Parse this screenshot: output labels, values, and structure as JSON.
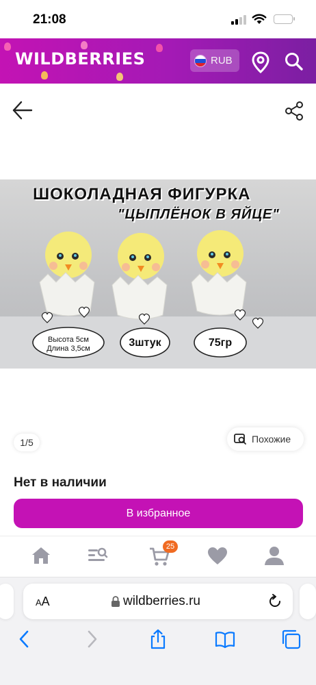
{
  "status_bar": {
    "time": "21:08"
  },
  "header": {
    "logo": "WILDBERRIES",
    "currency": "RUB"
  },
  "product": {
    "image": {
      "title": "ШОКОЛАДНАЯ ФИГУРКА",
      "subtitle": "\"ЦЫПЛЁНОК В ЯЙЦЕ\"",
      "label_height": "Высота 5см",
      "label_length": "Длина 3,5см",
      "label_count": "3штук",
      "label_weight": "75гр"
    },
    "page_counter": "1/5",
    "similar_label": "Похожие",
    "stock_status": "Нет в наличии",
    "favorite_button": "В избранное"
  },
  "tabbar": {
    "cart_badge": "25"
  },
  "browser": {
    "aa_label_small": "A",
    "aa_label_big": "A",
    "url": "wildberries.ru"
  },
  "colors": {
    "brand": "#c412b5",
    "badge": "#f06b22",
    "ios_blue": "#0a7aff"
  },
  "icons": [
    "signal-icon",
    "wifi-icon",
    "battery-icon",
    "location-icon",
    "search-icon",
    "back-arrow-icon",
    "share-icon",
    "similar-icon",
    "home-icon",
    "catalog-icon",
    "cart-icon",
    "heart-icon",
    "profile-icon",
    "lock-icon",
    "reload-icon",
    "chevron-left-icon",
    "chevron-right-icon",
    "share-up-icon",
    "bookmarks-icon",
    "tabs-icon"
  ]
}
